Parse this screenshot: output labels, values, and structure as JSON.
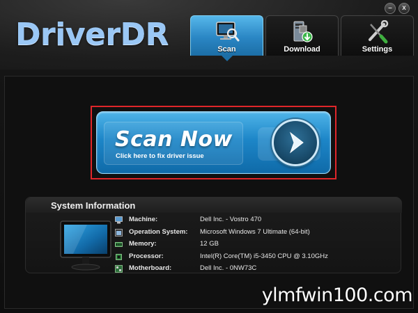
{
  "app": {
    "title": "DriverDR"
  },
  "window_controls": {
    "minimize": "–",
    "close": "x"
  },
  "tabs": [
    {
      "label": "Scan",
      "icon": "monitor-magnifier-icon",
      "active": true
    },
    {
      "label": "Download",
      "icon": "computer-download-icon",
      "active": false
    },
    {
      "label": "Settings",
      "icon": "wrench-screwdriver-icon",
      "active": false
    }
  ],
  "scan": {
    "title": "Scan Now",
    "subtitle": "Click here to fix driver issue",
    "arrow_icon": "play-arrow-icon"
  },
  "system_info": {
    "title": "System Information",
    "rows": [
      {
        "label": "Machine:",
        "value": "Dell Inc. - Vostro 470",
        "icon": "computer-icon"
      },
      {
        "label": "Operation System:",
        "value": "Microsoft Windows 7 Ultimate  (64-bit)",
        "icon": "os-window-icon"
      },
      {
        "label": "Memory:",
        "value": "12 GB",
        "icon": "memory-icon"
      },
      {
        "label": "Processor:",
        "value": "Intel(R) Core(TM) i5-3450 CPU @ 3.10GHz",
        "icon": "processor-icon"
      },
      {
        "label": "Motherboard:",
        "value": "Dell Inc. - 0NW73C",
        "icon": "motherboard-icon"
      }
    ]
  },
  "watermark": "ylmfwin100.com",
  "colors": {
    "accent": "#2a86c4",
    "highlight": "#e0262a",
    "title": "#9ac7f5"
  }
}
